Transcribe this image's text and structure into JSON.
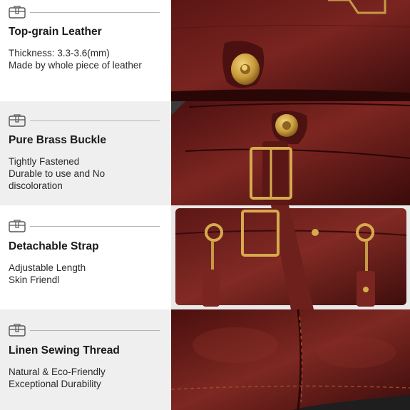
{
  "features": [
    {
      "title": "Top-grain Leather",
      "lines": [
        "Thickness: 3.3-3.6(mm)",
        "Made by whole piece of leather"
      ],
      "icon": "bag-icon",
      "image": "leather-flap-photo"
    },
    {
      "title": "Pure Brass Buckle",
      "lines": [
        "Tightly Fastened",
        "Durable to use and No",
        "discoloration"
      ],
      "icon": "bag-icon",
      "image": "brass-buckle-photo"
    },
    {
      "title": "Detachable Strap",
      "lines": [
        "Adjustable Length",
        "Skin Friendl"
      ],
      "icon": "bag-icon",
      "image": "strap-clip-photo"
    },
    {
      "title": "Linen Sewing Thread",
      "lines": [
        "Natural & Eco-Friendly",
        "Exceptional Durability"
      ],
      "icon": "bag-icon",
      "image": "stitching-photo"
    }
  ],
  "colors": {
    "leather_dark": "#3a0c0c",
    "leather_mid": "#6b1c1a",
    "leather_light": "#8e2f27",
    "brass": "#c9a24a",
    "panel_gray": "#efefef"
  }
}
